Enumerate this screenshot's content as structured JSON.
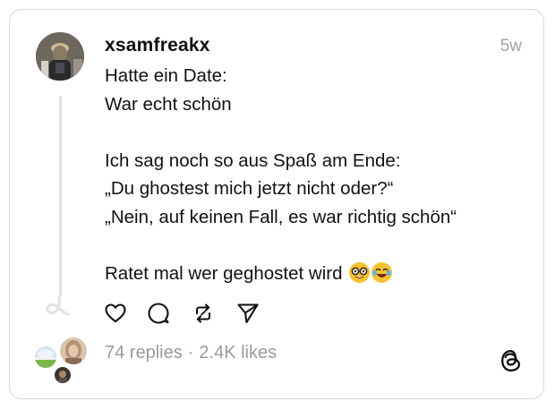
{
  "post": {
    "username": "xsamfreakx",
    "timestamp": "5w",
    "lines": [
      "Hatte ein Date:",
      "War echt schön",
      "",
      "Ich sag noch so aus Spaß am Ende:",
      "„Du ghostest mich jetzt nicht oder?“",
      "„Nein, auf keinen Fall, es war richtig schön“",
      "",
      "Ratet mal wer geghostet wird"
    ],
    "emojis": [
      "nerd-face-emoji",
      "laughing-tears-emoji"
    ]
  },
  "actions": [
    {
      "name": "like",
      "icon": "heart-icon"
    },
    {
      "name": "reply",
      "icon": "comment-icon"
    },
    {
      "name": "repost",
      "icon": "repost-icon"
    },
    {
      "name": "share",
      "icon": "send-icon"
    }
  ],
  "stats": {
    "replies": "74 replies",
    "separator": "·",
    "likes": "2.4K likes"
  },
  "colors": {
    "text": "#111111",
    "muted": "#9a9a9a",
    "border": "#d9d9d9",
    "thread_line": "#e2e2e2",
    "emoji_yellow": "#f6c233"
  },
  "icons": {
    "brand": "threads-logo-icon"
  }
}
